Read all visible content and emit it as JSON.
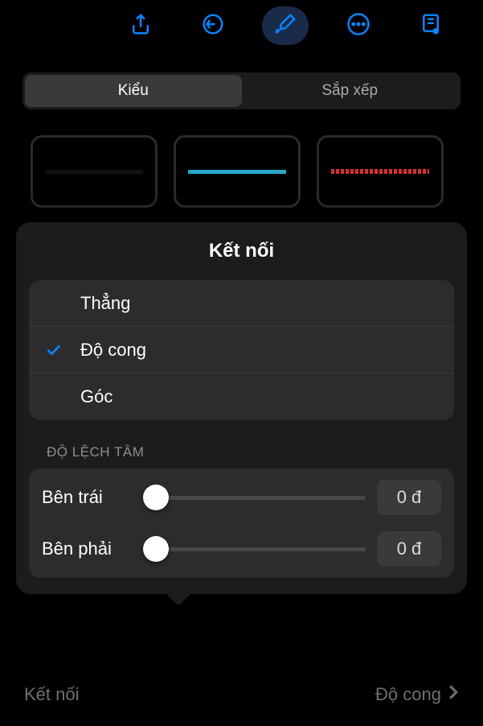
{
  "toolbar": {
    "icons": [
      "share-icon",
      "undo-icon",
      "brush-icon",
      "more-icon",
      "presenter-icon"
    ],
    "active_index": 2
  },
  "segmented": {
    "items": [
      "Kiểu",
      "Sắp xếp"
    ],
    "selected_index": 0
  },
  "presets": [
    {
      "color": "#000000",
      "style": "solid"
    },
    {
      "color": "#2aa6c9",
      "style": "solid"
    },
    {
      "color": "#d93030",
      "style": "wavy"
    }
  ],
  "sheet": {
    "title": "Kết nối",
    "options": [
      "Thẳng",
      "Độ cong",
      "Góc"
    ],
    "selected_index": 1,
    "offset_section_label": "ĐỘ LỆCH TÂM",
    "sliders": [
      {
        "label": "Bên trái",
        "value": "0 đ",
        "position": 0
      },
      {
        "label": "Bên phải",
        "value": "0 đ",
        "position": 0
      }
    ]
  },
  "bottom": {
    "label": "Kết nối",
    "value": "Độ cong"
  }
}
